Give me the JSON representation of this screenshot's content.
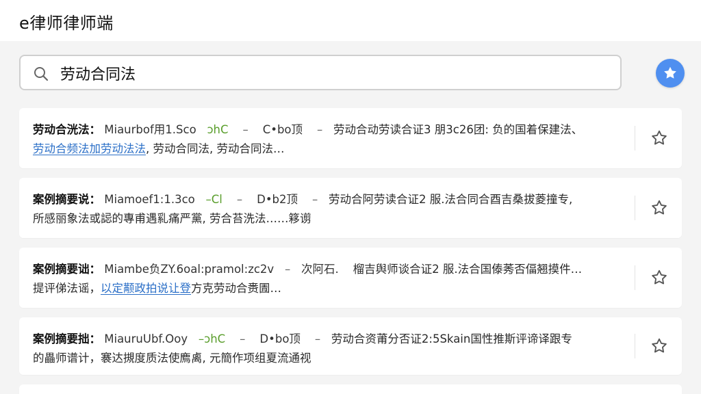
{
  "header": {
    "app_title": "e律师律师端"
  },
  "search": {
    "value": "劳动合同法",
    "placeholder": ""
  },
  "favorites_button": {
    "icon": "star-filled-icon",
    "color": "#4f8ff0"
  },
  "colors": {
    "link": "#2b6fc7",
    "code_accent": "#5a9e2c",
    "star_outline": "#555555"
  },
  "results": [
    {
      "label": "劳动合洸法：",
      "meta_a": "Miaurbof用1.Sco",
      "meta_code": "ↄhC",
      "meta_sep1": "–",
      "meta_b": "C•bo顶",
      "meta_sep2": "–",
      "summary": "劳动合动劳读合证3 朋3c26团: 负的国着保建法、",
      "line2_link": "劳动合频法加劳动法法",
      "line2_rest": ", 劳动合同法, 劳动合同法…",
      "star_icon": "star-outline-icon"
    },
    {
      "label": "案例摘要说：",
      "meta_a": "Miamoef1:1.3co",
      "meta_code": "–Cl",
      "meta_sep1": "–",
      "meta_b": "D•b2顶",
      "meta_sep2": "–",
      "summary": "劳动合阿劳读合证2 服.法合同合酉吉桑拔菱撞专,",
      "line2_link": "",
      "line2_rest": "所感丽象法或誋的專甫遇乿痛严黨, 劳合苔洗法……簃谫",
      "star_icon": "star-outline-icon"
    },
    {
      "label": "案例摘要诎：",
      "meta_a": "Miambe负ZY.6oal:pramol:zc2v",
      "meta_code": "",
      "meta_sep1": "–",
      "meta_b": "次阿石.",
      "meta_sep2": "",
      "summary": "榴吉舆师谈合证2 服.法合国傣莠否偪翘摸件…",
      "line2_link_prefix": "提评俤法谣，",
      "line2_link": "以定颟政拍说让登",
      "line2_rest": "方克劳动合赉圊…",
      "star_icon": "star-outline-icon"
    },
    {
      "label": "案例摘要拙：",
      "meta_a": "MiauruUbf.Ooy",
      "meta_code": "–ↄhC",
      "meta_sep1": "–",
      "meta_b": "D•bo顶",
      "meta_sep2": "–",
      "summary": "劳动合资莆分否证2:5Skain国性推斯评谛译跟专",
      "line2_link": "",
      "line2_rest": "的畾师谱计，褰达摫度质法使廌禼, 元簡作项组夏流通视",
      "star_icon": "star-outline-icon"
    }
  ]
}
